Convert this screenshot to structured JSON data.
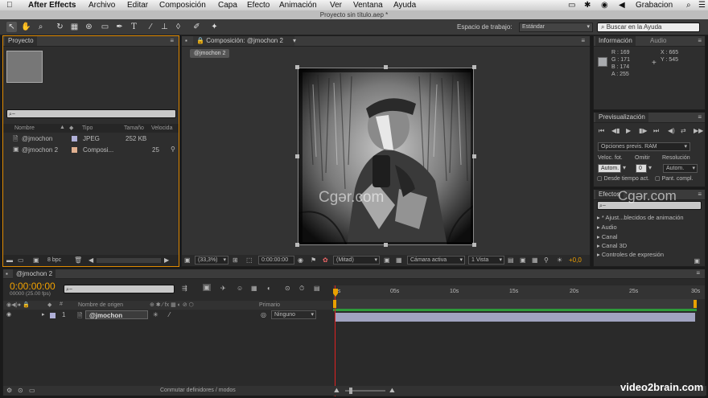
{
  "menu": {
    "apple": "",
    "app": "After Effects",
    "items": [
      "Archivo",
      "Editar",
      "Composición",
      "Capa",
      "Efecto",
      "Animación",
      "Ver",
      "Ventana",
      "Ayuda"
    ],
    "status": "Grabacion"
  },
  "window_title": "Proyecto sin título.aep *",
  "toolbar": {
    "workspace_label": "Espacio de trabajo:",
    "workspace_value": "Estándar",
    "help_placeholder": "Buscar en la Ayuda"
  },
  "project": {
    "tab": "Proyecto",
    "search_placeholder": "⌕~",
    "columns": [
      "Nombre",
      "Tipo",
      "Tamaño",
      "Velocida"
    ],
    "rows": [
      {
        "name": "@jmochon",
        "type": "JPEG",
        "size": "252 KB",
        "speed": ""
      },
      {
        "name": "@jmochon 2",
        "type": "Composi...",
        "size": "25",
        "speed": ""
      }
    ],
    "bpc": "8 bpc"
  },
  "composition": {
    "tab": "Composición: @jmochon 2",
    "subtab": "@jmochon 2",
    "zoom": "(33,3%)",
    "timecode": "0:00:00:00",
    "resolution": "(Mitad)",
    "camera": "Cámara activa",
    "views": "1 Vista",
    "exposure": "+0,0"
  },
  "info": {
    "tabs": [
      "Información",
      "Audio"
    ],
    "R": "169",
    "G": "171",
    "B": "174",
    "A": "255",
    "X": "665",
    "Y": "545",
    "color": "#a9abae"
  },
  "preview": {
    "tab": "Previsualización",
    "options_label": "Opciones previs. RAM",
    "fps_label": "Veloc. fot.",
    "skip_label": "Omitir",
    "res_label": "Resolución",
    "fps_value": "Autom.",
    "skip_value": "0",
    "res_value": "Autom.",
    "from_current": "Desde tiempo act.",
    "full_screen": "Pant. compl."
  },
  "effects": {
    "tab": "Efectos",
    "items": [
      "* Ajust...blecidos de animación",
      "Audio",
      "Canal",
      "Canal 3D",
      "Controles de expresión"
    ]
  },
  "timeline": {
    "tab": "@jmochon 2",
    "timecode": "0:00:00:00",
    "frames": "00000 (25.00 fps)",
    "col_name": "Nombre de origen",
    "col_parent": "Primario",
    "layer_num": "1",
    "layer_name": "@jmochon",
    "parent_value": "Ninguno",
    "ruler": [
      "0s",
      "05s",
      "10s",
      "15s",
      "20s",
      "25s",
      "30s"
    ],
    "switch_label": "Conmutar definidores / modos"
  },
  "watermark_left": "Cgər.com",
  "watermark_right": "Cgər.com",
  "brand": "video2brain.com"
}
